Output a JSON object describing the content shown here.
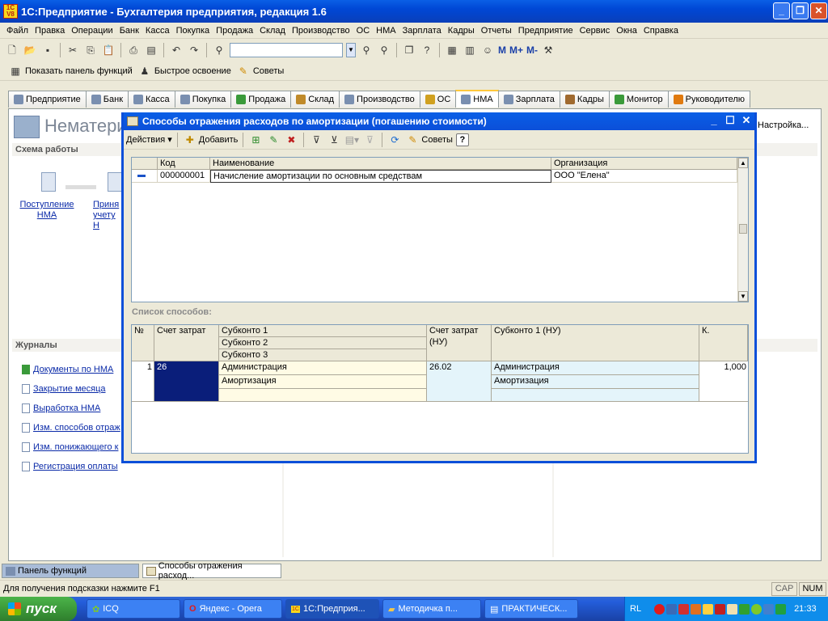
{
  "app": {
    "title": "1С:Предприятие - Бухгалтерия предприятия, редакция 1.6",
    "logo_text": "1С V8"
  },
  "menu": [
    "Файл",
    "Правка",
    "Операции",
    "Банк",
    "Касса",
    "Покупка",
    "Продажа",
    "Склад",
    "Производство",
    "ОС",
    "НМА",
    "Зарплата",
    "Кадры",
    "Отчеты",
    "Предприятие",
    "Сервис",
    "Окна",
    "Справка"
  ],
  "toolbar2": {
    "show_panel": "Показать панель функций",
    "quick_learn": "Быстрое освоение",
    "tips": "Советы"
  },
  "tabs": [
    "Предприятие",
    "Банк",
    "Касса",
    "Покупка",
    "Продажа",
    "Склад",
    "Производство",
    "ОС",
    "НМА",
    "Зарплата",
    "Кадры",
    "Монитор",
    "Руководителю"
  ],
  "bg": {
    "heading": "Нематери",
    "schema": "Схема работы",
    "settings": "Настройка...",
    "node1": "Поступление НМА",
    "node2": "Приня учету Н",
    "journals": "Журналы",
    "journal_items": [
      "Документы по НМА",
      "Закрытие месяца",
      "Выработка НМА",
      "Изм. способов отраж",
      "Изм. понижающего к",
      "Регистрация оплаты"
    ]
  },
  "win": {
    "title": "Способы отражения расходов по амортизации (погашению стоимости)",
    "actions": "Действия",
    "add": "Добавить",
    "tips": "Советы",
    "help": "?",
    "grid": {
      "headers": [
        "Код",
        "Наименование",
        "Организация"
      ],
      "row": {
        "code": "000000001",
        "name": "Начисление амортизации по основным средствам",
        "org": "ООО \"Елена\""
      }
    },
    "list_label": "Список способов:",
    "grid2": {
      "headers": {
        "n": "№",
        "acc": "Счет затрат",
        "sub1": "Субконто 1",
        "sub2": "Субконто 2",
        "sub3": "Субконто 3",
        "acc_nu": "Счет затрат (НУ)",
        "sub_nu": "Субконто 1 (НУ)",
        "k": "К."
      },
      "row": {
        "n": "1",
        "acc": "26",
        "sub1": "Администрация",
        "sub2": "Амортизация",
        "sub3": "",
        "acc_nu": "26.02",
        "sub_nu1": "Администрация",
        "sub_nu2": "Амортизация",
        "k": "1,000"
      }
    }
  },
  "taskpanel": [
    "Панель функций",
    "Способы отражения расход..."
  ],
  "status": {
    "hint": "Для получения подсказки нажмите F1",
    "cap": "CAP",
    "num": "NUM"
  },
  "taskbar": {
    "start": "пуск",
    "items": [
      "ICQ",
      "Яндекс - Opera",
      "1С:Предприя...",
      "Методичка п...",
      "ПРАКТИЧЕСК..."
    ],
    "lang": "RL",
    "clock": "21:33"
  }
}
